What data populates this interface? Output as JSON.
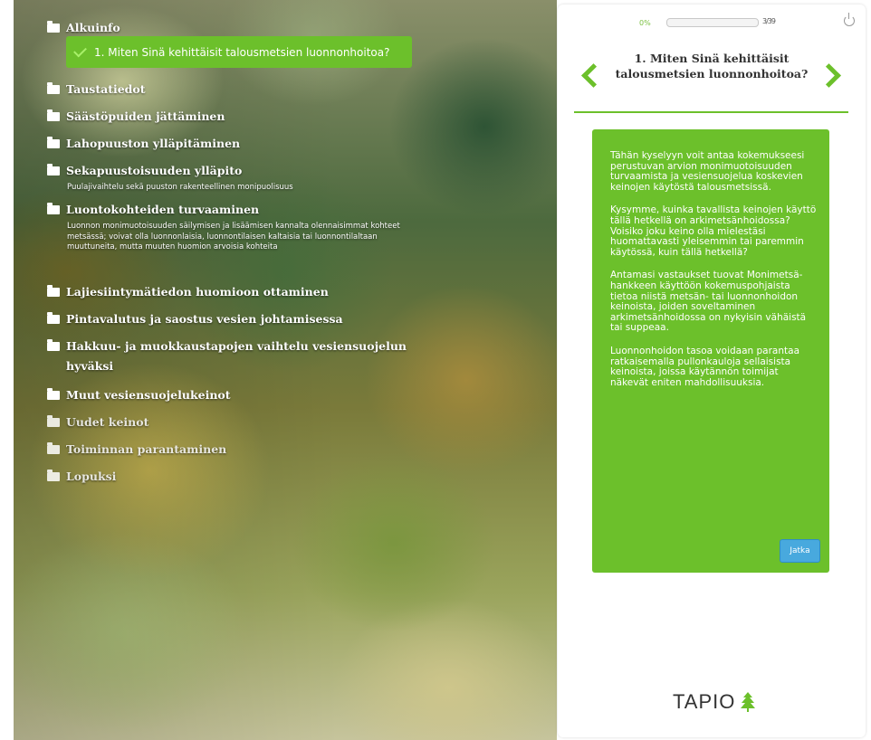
{
  "nav": {
    "sections": [
      {
        "title": "Alkuinfo"
      },
      {
        "title": "Taustatiedot"
      },
      {
        "title": "Säästöpuiden jättäminen"
      },
      {
        "title": "Lahopuuston ylläpitäminen"
      },
      {
        "title": "Sekapuustoisuuden ylläpito",
        "subtitle": "Puulajivaihtelu sekä puuston rakenteellinen monipuolisuus"
      },
      {
        "title": "Luontokohteiden turvaaminen",
        "subtitle": "Luonnon monimuotoisuuden säilymisen ja lisäämisen kannalta olennaisimmat kohteet metsässä; voivat olla luonnonlaisia, luonnontilaisen kaltaisia tai luonnontilaltaan muuttuneita, mutta muuten huomion arvoisia kohteita"
      },
      {
        "title": "Lajiesiintymätiedon huomioon ottaminen"
      },
      {
        "title": "Pintavalutus ja saostus vesien johtamisessa"
      },
      {
        "title": "Hakkuu- ja muokkaustapojen vaihtelu vesiensuojelun hyväksi"
      },
      {
        "title": "Muut vesiensuojelukeinot"
      },
      {
        "title": "Uudet keinot"
      },
      {
        "title": "Toiminnan parantaminen"
      },
      {
        "title": "Lopuksi"
      }
    ],
    "active_question": "1. Miten Sinä kehittäisit talousmetsien luonnonhoitoa?"
  },
  "panel": {
    "progress_label": "0%",
    "progress_value": 0,
    "progress_ratio": "3/39",
    "question_title": "1. Miten Sinä kehittäisit talousmetsien luonnonhoitoa?",
    "paragraphs": [
      "Tähän kyselyyn voit antaa kokemukseesi perustuvan arvion monimuotoisuuden turvaamista ja vesiensuojelua koskevien keinojen käytöstä talousmetsissä.",
      "Kysymme, kuinka tavallista keinojen käyttö tällä hetkellä on arkimetsänhoidossa? Voisiko joku keino olla mielestäsi huomattavasti yleisemmin tai paremmin käytössä, kuin tällä hetkellä?",
      "Antamasi vastaukset tuovat Monimetsä-hankkeen käyttöön kokemuspohjaista tietoa niistä metsän- tai luonnonhoidon keinoista, joiden soveltaminen arkimetsänhoidossa on nykyisin vähäistä tai suppeaa.",
      "Luonnonhoidon tasoa voidaan parantaa ratkaisemalla pullonkauloja sellaisista keinoista, joissa käytännön toimijat näkevät eniten mahdollisuuksia."
    ],
    "continue_label": "Jatka",
    "brand": "TAPIO"
  },
  "colors": {
    "accent_green": "#6cc02b",
    "button_blue": "#48a9de"
  },
  "icons": [
    "folder-icon",
    "check-icon",
    "chevron-left-icon",
    "chevron-right-icon",
    "power-icon",
    "tree-icon"
  ]
}
